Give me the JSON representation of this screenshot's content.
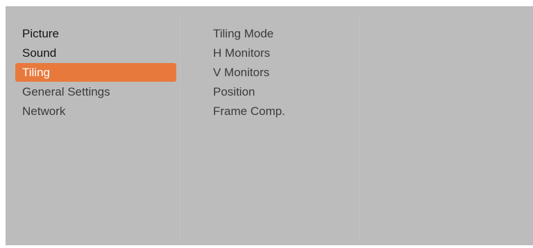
{
  "main_menu": {
    "items": [
      {
        "label": "Picture"
      },
      {
        "label": "Sound"
      },
      {
        "label": "Tiling"
      },
      {
        "label": "General Settings"
      },
      {
        "label": "Network"
      }
    ],
    "selected_label": "Tiling"
  },
  "submenu": {
    "items": [
      {
        "label": "Tiling Mode"
      },
      {
        "label": "H Monitors"
      },
      {
        "label": "V Monitors"
      },
      {
        "label": "Position"
      },
      {
        "label": "Frame Comp."
      }
    ]
  },
  "colors": {
    "panel_background": "#bcbcbc",
    "selection_highlight": "#e8793c",
    "selected_text": "#ffffff",
    "primary_text": "#141414",
    "secondary_text": "#3b3b3b"
  }
}
